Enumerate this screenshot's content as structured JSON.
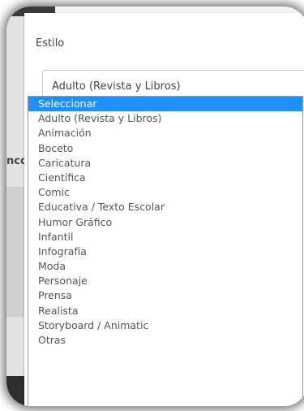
{
  "background": {
    "partial_text": "ncor"
  },
  "field": {
    "label": "Estilo",
    "selected_value": "Adulto (Revista y Libros)"
  },
  "dropdown": {
    "highlight_color": "#1e90ff",
    "options": [
      {
        "label": "Seleccionar",
        "highlighted": true
      },
      {
        "label": "Adulto (Revista y Libros)",
        "highlighted": false
      },
      {
        "label": "Animación",
        "highlighted": false
      },
      {
        "label": "Boceto",
        "highlighted": false
      },
      {
        "label": "Caricatura",
        "highlighted": false
      },
      {
        "label": "Científica",
        "highlighted": false
      },
      {
        "label": "Comic",
        "highlighted": false
      },
      {
        "label": "Educativa / Texto Escolar",
        "highlighted": false
      },
      {
        "label": "Humor Gráfico",
        "highlighted": false
      },
      {
        "label": "Infantil",
        "highlighted": false
      },
      {
        "label": "Infografía",
        "highlighted": false
      },
      {
        "label": "Moda",
        "highlighted": false
      },
      {
        "label": "Personaje",
        "highlighted": false
      },
      {
        "label": "Prensa",
        "highlighted": false
      },
      {
        "label": "Realista",
        "highlighted": false
      },
      {
        "label": "Storyboard / Animatic",
        "highlighted": false
      },
      {
        "label": "Otras",
        "highlighted": false
      }
    ]
  }
}
